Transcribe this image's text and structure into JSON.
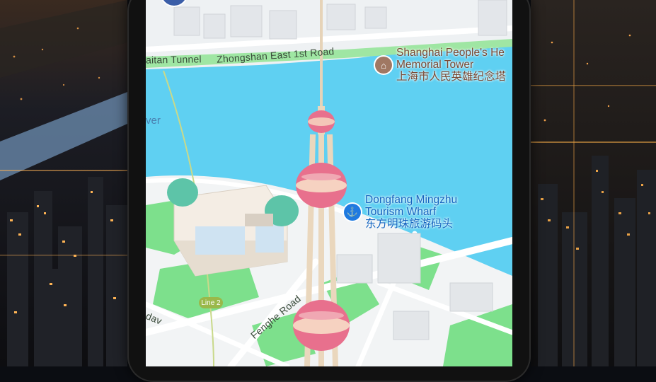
{
  "map": {
    "roads": {
      "tunnel": "aitan Tunnel",
      "zhongshan": "Zhongshan East 1st Road",
      "fenghe": "Fenghe Road",
      "partial_bottom": "dav",
      "river_partial": "ver"
    },
    "pois": {
      "memorial": {
        "name_en_line1": "Shanghai People's He",
        "name_en_line2": "Memorial Tower",
        "name_zh": "上海市人民英雄纪念塔",
        "icon": "monument-icon"
      },
      "wharf": {
        "name_en_line1": "Dongfang Mingzhu",
        "name_en_line2": "Tourism Wharf",
        "name_zh": "东方明珠旅游码头",
        "icon": "anchor-icon"
      }
    },
    "transit": {
      "line_badge": "Line 2"
    },
    "colors": {
      "water": "#5fd0f2",
      "land": "#f1f3f4",
      "park": "#7de08c",
      "tower_pink": "#e8708d"
    }
  }
}
